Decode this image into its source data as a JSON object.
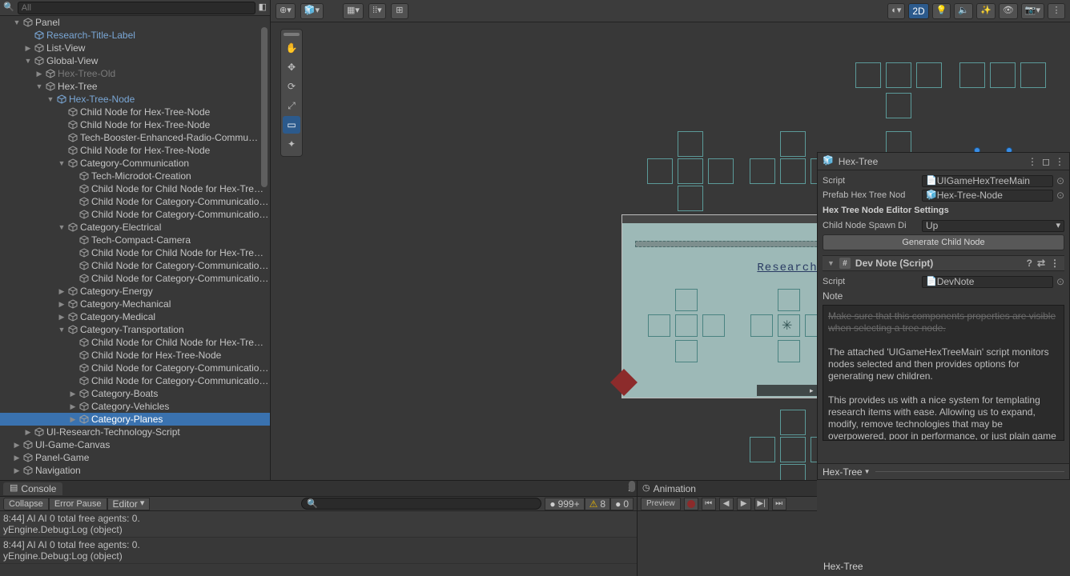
{
  "hierarchy": {
    "search_placeholder": "All",
    "items": [
      {
        "d": 1,
        "ex": "open",
        "t": "obj",
        "label": "Panel"
      },
      {
        "d": 2,
        "ex": "",
        "t": "prefab",
        "label": "Research-Title-Label",
        "more": true
      },
      {
        "d": 2,
        "ex": "closed",
        "t": "obj",
        "label": "List-View"
      },
      {
        "d": 2,
        "ex": "open",
        "t": "obj",
        "label": "Global-View"
      },
      {
        "d": 3,
        "ex": "closed",
        "t": "muted",
        "label": "Hex-Tree-Old"
      },
      {
        "d": 3,
        "ex": "open",
        "t": "obj",
        "label": "Hex-Tree"
      },
      {
        "d": 4,
        "ex": "open",
        "t": "prefab",
        "label": "Hex-Tree-Node",
        "more": true
      },
      {
        "d": 5,
        "ex": "",
        "t": "obj",
        "label": "Child Node for Hex-Tree-Node"
      },
      {
        "d": 5,
        "ex": "",
        "t": "obj",
        "label": "Child Node for Hex-Tree-Node"
      },
      {
        "d": 5,
        "ex": "",
        "t": "obj",
        "label": "Tech-Booster-Enhanced-Radio-Commu…"
      },
      {
        "d": 5,
        "ex": "",
        "t": "obj",
        "label": "Child Node for Hex-Tree-Node"
      },
      {
        "d": 5,
        "ex": "open",
        "t": "obj",
        "label": "Category-Communication"
      },
      {
        "d": 6,
        "ex": "",
        "t": "obj",
        "label": "Tech-Microdot-Creation"
      },
      {
        "d": 6,
        "ex": "",
        "t": "obj",
        "label": "Child Node for Child Node for Hex-Tre…"
      },
      {
        "d": 6,
        "ex": "",
        "t": "obj",
        "label": "Child Node for Category-Communicatio…"
      },
      {
        "d": 6,
        "ex": "",
        "t": "obj",
        "label": "Child Node for Category-Communicatio…"
      },
      {
        "d": 5,
        "ex": "open",
        "t": "obj",
        "label": "Category-Electrical"
      },
      {
        "d": 6,
        "ex": "",
        "t": "obj",
        "label": "Tech-Compact-Camera"
      },
      {
        "d": 6,
        "ex": "",
        "t": "obj",
        "label": "Child Node for Child Node for Hex-Tre…"
      },
      {
        "d": 6,
        "ex": "",
        "t": "obj",
        "label": "Child Node for Category-Communicatio…"
      },
      {
        "d": 6,
        "ex": "",
        "t": "obj",
        "label": "Child Node for Category-Communicatio…"
      },
      {
        "d": 5,
        "ex": "closed",
        "t": "obj",
        "label": "Category-Energy"
      },
      {
        "d": 5,
        "ex": "closed",
        "t": "obj",
        "label": "Category-Mechanical"
      },
      {
        "d": 5,
        "ex": "closed",
        "t": "obj",
        "label": "Category-Medical"
      },
      {
        "d": 5,
        "ex": "open",
        "t": "obj",
        "label": "Category-Transportation"
      },
      {
        "d": 6,
        "ex": "",
        "t": "obj",
        "label": "Child Node for Child Node for Hex-Tre…"
      },
      {
        "d": 6,
        "ex": "",
        "t": "obj",
        "label": "Child Node for Hex-Tree-Node"
      },
      {
        "d": 6,
        "ex": "",
        "t": "obj",
        "label": "Child Node for Category-Communicatio…"
      },
      {
        "d": 6,
        "ex": "",
        "t": "obj",
        "label": "Child Node for Category-Communicatio…"
      },
      {
        "d": 6,
        "ex": "closed",
        "t": "obj",
        "label": "Category-Boats"
      },
      {
        "d": 6,
        "ex": "closed",
        "t": "obj",
        "label": "Category-Vehicles"
      },
      {
        "d": 6,
        "ex": "closed",
        "t": "obj",
        "label": "Category-Planes",
        "selected": true
      },
      {
        "d": 2,
        "ex": "closed",
        "t": "obj",
        "label": "UI-Research-Technology-Script"
      },
      {
        "d": 1,
        "ex": "closed",
        "t": "obj",
        "label": "UI-Game-Canvas"
      },
      {
        "d": 1,
        "ex": "closed",
        "t": "obj",
        "label": "Panel-Game"
      },
      {
        "d": 1,
        "ex": "closed",
        "t": "obj",
        "label": "Navigation"
      }
    ]
  },
  "scene_toolbar": {
    "btn_2d": "2D"
  },
  "preview": {
    "title": "Research"
  },
  "inspector": {
    "title": "Hex-Tree",
    "script_label": "Script",
    "script_value": "UIGameHexTreeMain",
    "prefab_label": "Prefab Hex Tree Nod",
    "prefab_value": "Hex-Tree-Node",
    "section_title": "Hex Tree Node Editor Settings",
    "spawn_label": "Child Node Spawn Di",
    "spawn_value": "Up",
    "generate_btn": "Generate Child Node",
    "devnote": {
      "header": "Dev Note (Script)",
      "script_label": "Script",
      "script_value": "DevNote",
      "note_label": "Note",
      "note_p0": "Make sure that this components properties are visible when selecting a tree node.",
      "note_p1": "The attached 'UIGameHexTreeMain' script monitors nodes selected and then provides options for generating new children.",
      "note_p2": "This provides us with a nice system for templating research items with ease. Allowing us to expand, modify, remove technologies that may be overpowered, poor in performance, or just plain game breaking and lame."
    },
    "footer": "Hex-Tree"
  },
  "bottom_crumb": "Hex-Tree",
  "console": {
    "tab": "Console",
    "btn_collapse": "Collapse",
    "btn_errpause": "Error Pause",
    "btn_editor": "Editor",
    "cnt_info": "999+",
    "cnt_warn": "8",
    "cnt_err": "0",
    "logs": [
      {
        "line1": "8:44] AI AI 0 total free agents: 0.",
        "line2": "yEngine.Debug:Log (object)"
      },
      {
        "line1": "8:44] AI AI 0 total free agents: 0.",
        "line2": "yEngine.Debug:Log (object)"
      }
    ]
  },
  "animation": {
    "tab": "Animation",
    "preview": "Preview"
  }
}
